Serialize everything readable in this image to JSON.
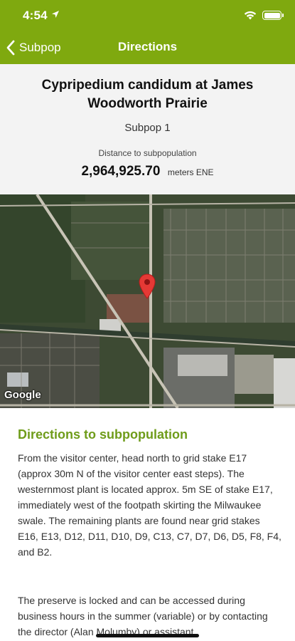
{
  "status_bar": {
    "time": "4:54"
  },
  "nav": {
    "back_label": "Subpop",
    "title": "Directions"
  },
  "header": {
    "species_site": "Cypripedium candidum at James Woodworth Prairie",
    "subpop": "Subpop 1",
    "distance_label": "Distance to subpopulation",
    "distance_value": "2,964,925.70",
    "distance_unit": "meters ENE"
  },
  "map": {
    "attribution": "Google",
    "pin_color": "#e53935"
  },
  "directions": {
    "heading": "Directions to subpopulation",
    "paragraph_1": "From the visitor center, head north to grid stake E17 (approx 30m N of the visitor center east steps). The westernmost plant is located approx. 5m SE of stake E17, immediately west of the footpath skirting the Milwaukee swale.  The remaining plants are found near grid stakes E16, E13, D12, D11, D10, D9, C13, C7, D7, D6, D5, F8, F4, and B2.",
    "paragraph_2": "The preserve is locked and can be accessed during business hours in the summer (variable) or by contacting the director (Alan Molumby) or assistant"
  },
  "colors": {
    "brand": "#7fa90f",
    "heading": "#6f9c1a"
  }
}
